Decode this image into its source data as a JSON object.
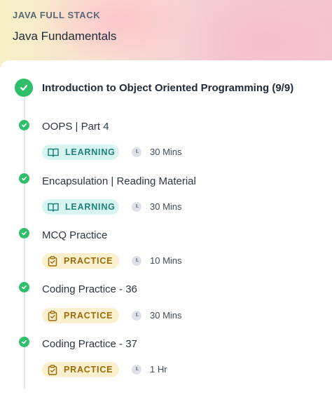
{
  "header": {
    "course_label": "JAVA FULL STACK",
    "course_title": "Java Fundamentals"
  },
  "section": {
    "title": "Introduction to Object Oriented Programming (9/9)",
    "status": "completed"
  },
  "colors": {
    "completed": "#2fbf6a",
    "learning_bg": "#d9f5f1",
    "learning_text": "#1b8378",
    "practice_bg": "#fbf0cd",
    "practice_text": "#9a6a0b"
  },
  "items": [
    {
      "title": "OOPS | Part 4",
      "type": "LEARNING",
      "icon": "book-icon",
      "duration": "30 Mins",
      "status": "completed"
    },
    {
      "title": "Encapsulation | Reading Material",
      "type": "LEARNING",
      "icon": "book-icon",
      "duration": "30 Mins",
      "status": "completed"
    },
    {
      "title": "MCQ Practice",
      "type": "PRACTICE",
      "icon": "clipboard-icon",
      "duration": "10 Mins",
      "status": "completed"
    },
    {
      "title": "Coding Practice - 36",
      "type": "PRACTICE",
      "icon": "clipboard-icon",
      "duration": "30 Mins",
      "status": "completed"
    },
    {
      "title": "Coding Practice - 37",
      "type": "PRACTICE",
      "icon": "clipboard-icon",
      "duration": "1 Hr",
      "status": "completed"
    }
  ]
}
